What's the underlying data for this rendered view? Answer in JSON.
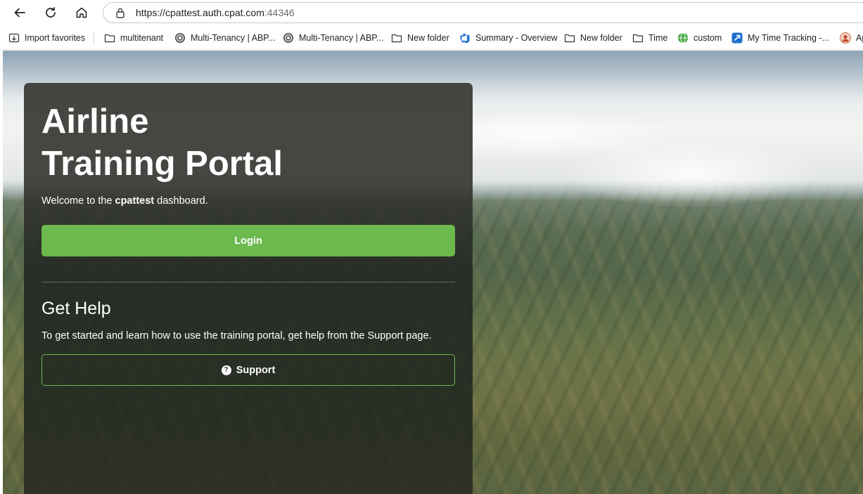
{
  "browser": {
    "url_main": "https://cpattest.auth.cpat.com",
    "url_port": ":44346",
    "icons": {
      "back": "back-arrow-icon",
      "refresh": "refresh-icon",
      "home": "home-icon",
      "lock": "lock-icon"
    }
  },
  "favorites": [
    {
      "label": "Import favorites",
      "icon": "import-icon"
    },
    {
      "label": "multitenant",
      "icon": "folder-icon"
    },
    {
      "label": "Multi-Tenancy | ABP...",
      "icon": "abp-icon"
    },
    {
      "label": "Multi-Tenancy | ABP...",
      "icon": "abp-icon"
    },
    {
      "label": "New folder",
      "icon": "folder-icon"
    },
    {
      "label": "Summary - Overview",
      "icon": "azure-devops-icon"
    },
    {
      "label": "New folder",
      "icon": "folder-icon"
    },
    {
      "label": "Time",
      "icon": "folder-icon"
    },
    {
      "label": "custom",
      "icon": "green-globe-icon"
    },
    {
      "label": "My Time Tracking -...",
      "icon": "jira-icon"
    },
    {
      "label": "Ap",
      "icon": "avatar-icon"
    }
  ],
  "card": {
    "title_line1": "Airline",
    "title_line2": "Training Portal",
    "welcome_prefix": "Welcome to the ",
    "welcome_tenant": "cpattest",
    "welcome_suffix": " dashboard.",
    "login_label": "Login",
    "help_heading": "Get Help",
    "help_text": "To get started and learn how to use the training portal, get help from the Support page.",
    "support_label": "Support",
    "support_icon": "question-circle-icon"
  },
  "colors": {
    "accent_green": "#6cb94d",
    "card_bg": "#2f3430"
  }
}
